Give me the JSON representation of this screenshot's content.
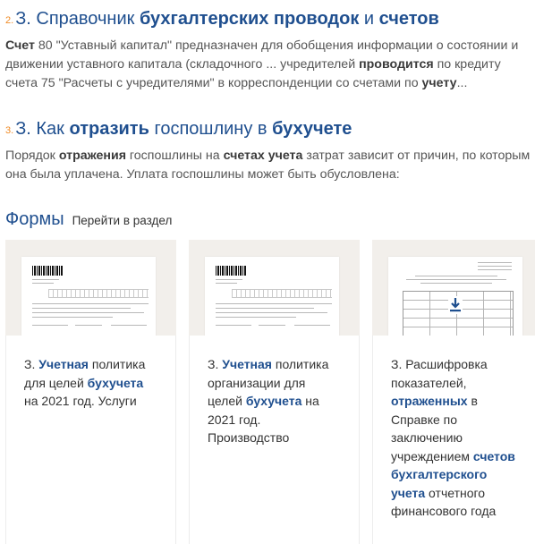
{
  "results": [
    {
      "num": "2.",
      "title_parts": [
        {
          "text": "З. Справочник ",
          "bold": false
        },
        {
          "text": "бухгалтерских проводок",
          "bold": true
        },
        {
          "text": " и ",
          "bold": false
        },
        {
          "text": "счетов",
          "bold": true
        }
      ],
      "snippet_parts": [
        {
          "text": "Счет",
          "bold": true
        },
        {
          "text": " 80 \"Уставный капитал\" предназначен для обобщения информации о состоянии и движении уставного капитала (складочного ... учредителей ",
          "bold": false
        },
        {
          "text": "проводится",
          "bold": true
        },
        {
          "text": " по кредиту счета 75 \"Расчеты с учредителями\" в корреспонденции со счетами по ",
          "bold": false
        },
        {
          "text": "учету",
          "bold": true
        },
        {
          "text": "...",
          "bold": false
        }
      ]
    },
    {
      "num": "3.",
      "title_parts": [
        {
          "text": "З. Как ",
          "bold": false
        },
        {
          "text": "отразить",
          "bold": true
        },
        {
          "text": " госпошлину в ",
          "bold": false
        },
        {
          "text": "бухучете",
          "bold": true
        }
      ],
      "snippet_parts": [
        {
          "text": "Порядок ",
          "bold": false
        },
        {
          "text": "отражения",
          "bold": true
        },
        {
          "text": " госпошлины на ",
          "bold": false
        },
        {
          "text": "счетах учета",
          "bold": true
        },
        {
          "text": " затрат зависит от причин, по которым она была уплачена. Уплата госпошлины может быть обусловлена:",
          "bold": false
        }
      ]
    }
  ],
  "forms": {
    "title": "Формы",
    "link": "Перейти в раздел",
    "cards": [
      {
        "parts": [
          {
            "text": "З. ",
            "bold": false
          },
          {
            "text": "Учетная",
            "bold": true
          },
          {
            "text": " политика для целей ",
            "bold": false
          },
          {
            "text": "бухучета",
            "bold": true
          },
          {
            "text": " на 2021 год. Услуги",
            "bold": false
          }
        ]
      },
      {
        "parts": [
          {
            "text": "З. ",
            "bold": false
          },
          {
            "text": "Учетная",
            "bold": true
          },
          {
            "text": " политика организации для целей ",
            "bold": false
          },
          {
            "text": "бухучета",
            "bold": true
          },
          {
            "text": " на 2021 год. Производство",
            "bold": false
          }
        ]
      },
      {
        "parts": [
          {
            "text": "З. Расшифровка показателей, ",
            "bold": false
          },
          {
            "text": "отраженных",
            "bold": true
          },
          {
            "text": " в Справке по заключению учреждением ",
            "bold": false
          },
          {
            "text": "счетов бухгалтерского учета",
            "bold": true
          },
          {
            "text": " отчетного финансового года",
            "bold": false
          }
        ]
      }
    ]
  },
  "colors": {
    "title_blue": "#1f4f8f",
    "number_orange": "#f08a24",
    "thumb_bg": "#f2efeb"
  }
}
